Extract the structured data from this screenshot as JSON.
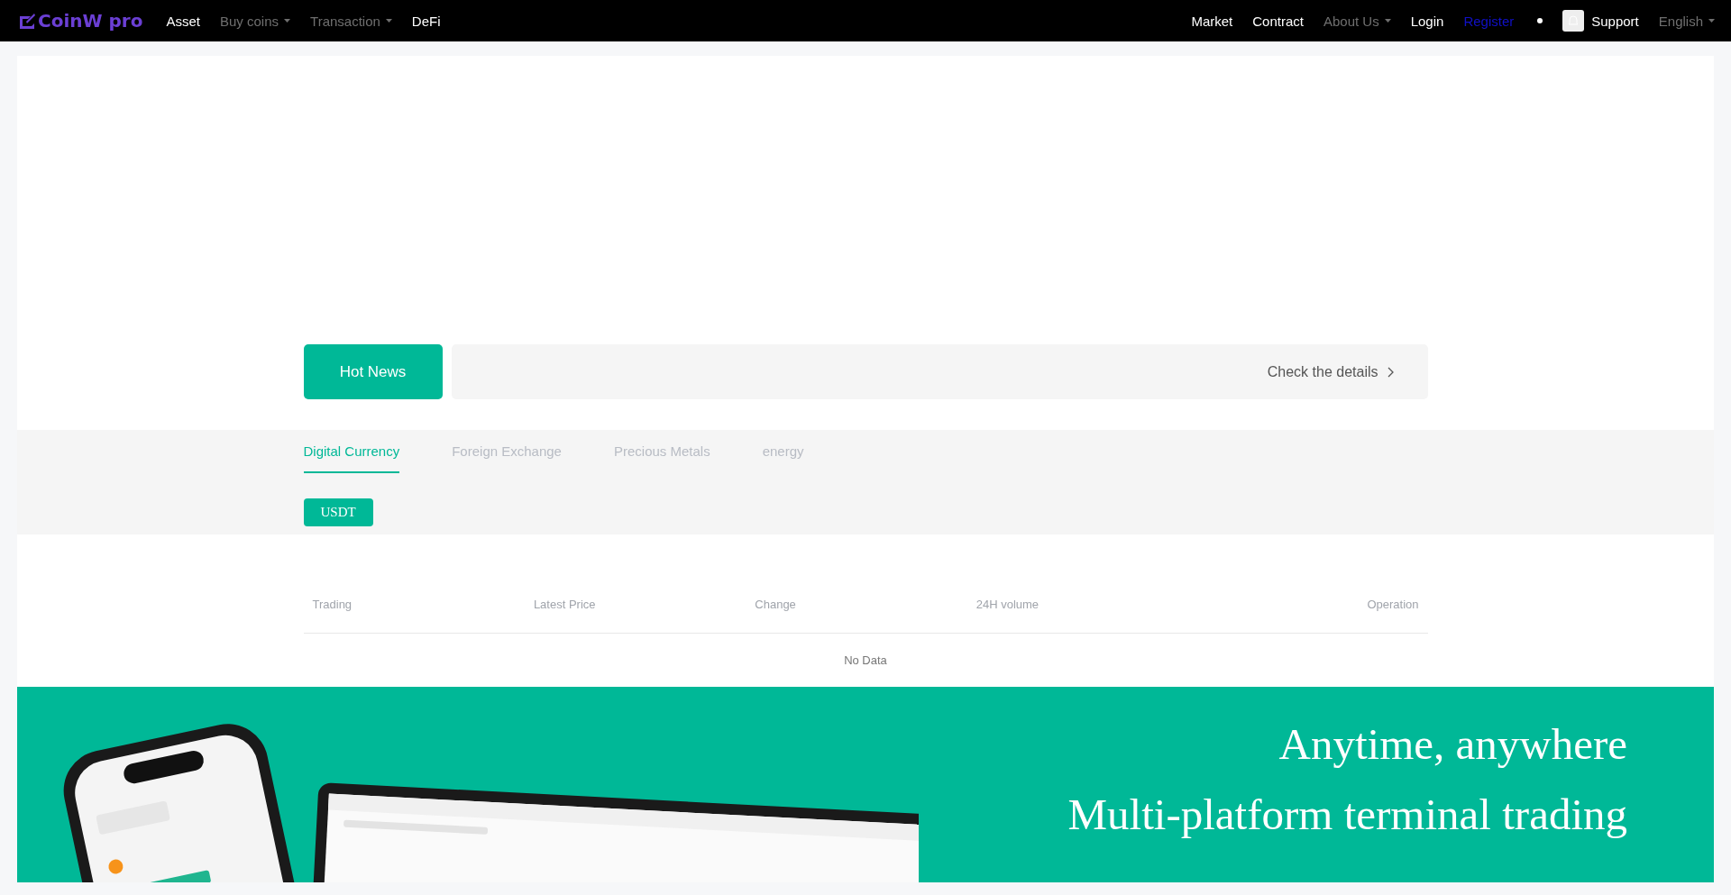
{
  "header": {
    "logo": "CoinW pro",
    "nav_left": [
      {
        "label": "Asset",
        "kind": "link"
      },
      {
        "label": "Buy coins",
        "kind": "dropdown"
      },
      {
        "label": "Transaction",
        "kind": "dropdown"
      },
      {
        "label": "DeFi",
        "kind": "link"
      }
    ],
    "nav_right": [
      {
        "label": "Market",
        "kind": "link"
      },
      {
        "label": "Contract",
        "kind": "link"
      },
      {
        "label": "About Us",
        "kind": "dropdown"
      },
      {
        "label": "Login",
        "kind": "link"
      },
      {
        "label": "Register",
        "kind": "register"
      },
      {
        "label": "Support",
        "kind": "support"
      },
      {
        "label": "English",
        "kind": "dropdown"
      }
    ]
  },
  "news": {
    "badge": "Hot News",
    "details": "Check the details"
  },
  "tabs": [
    {
      "label": "Digital Currency",
      "selected": true
    },
    {
      "label": "Foreign Exchange",
      "selected": false
    },
    {
      "label": "Precious Metals",
      "selected": false
    },
    {
      "label": "energy",
      "selected": false
    }
  ],
  "quote_buttons": [
    {
      "label": "USDT",
      "selected": true
    }
  ],
  "table": {
    "columns": [
      "Trading",
      "Latest Price",
      "Change",
      "24H volume",
      "Operation"
    ],
    "empty": "No Data"
  },
  "banner": {
    "lines": [
      "Anytime, anywhere",
      "Multi-platform terminal trading"
    ]
  }
}
